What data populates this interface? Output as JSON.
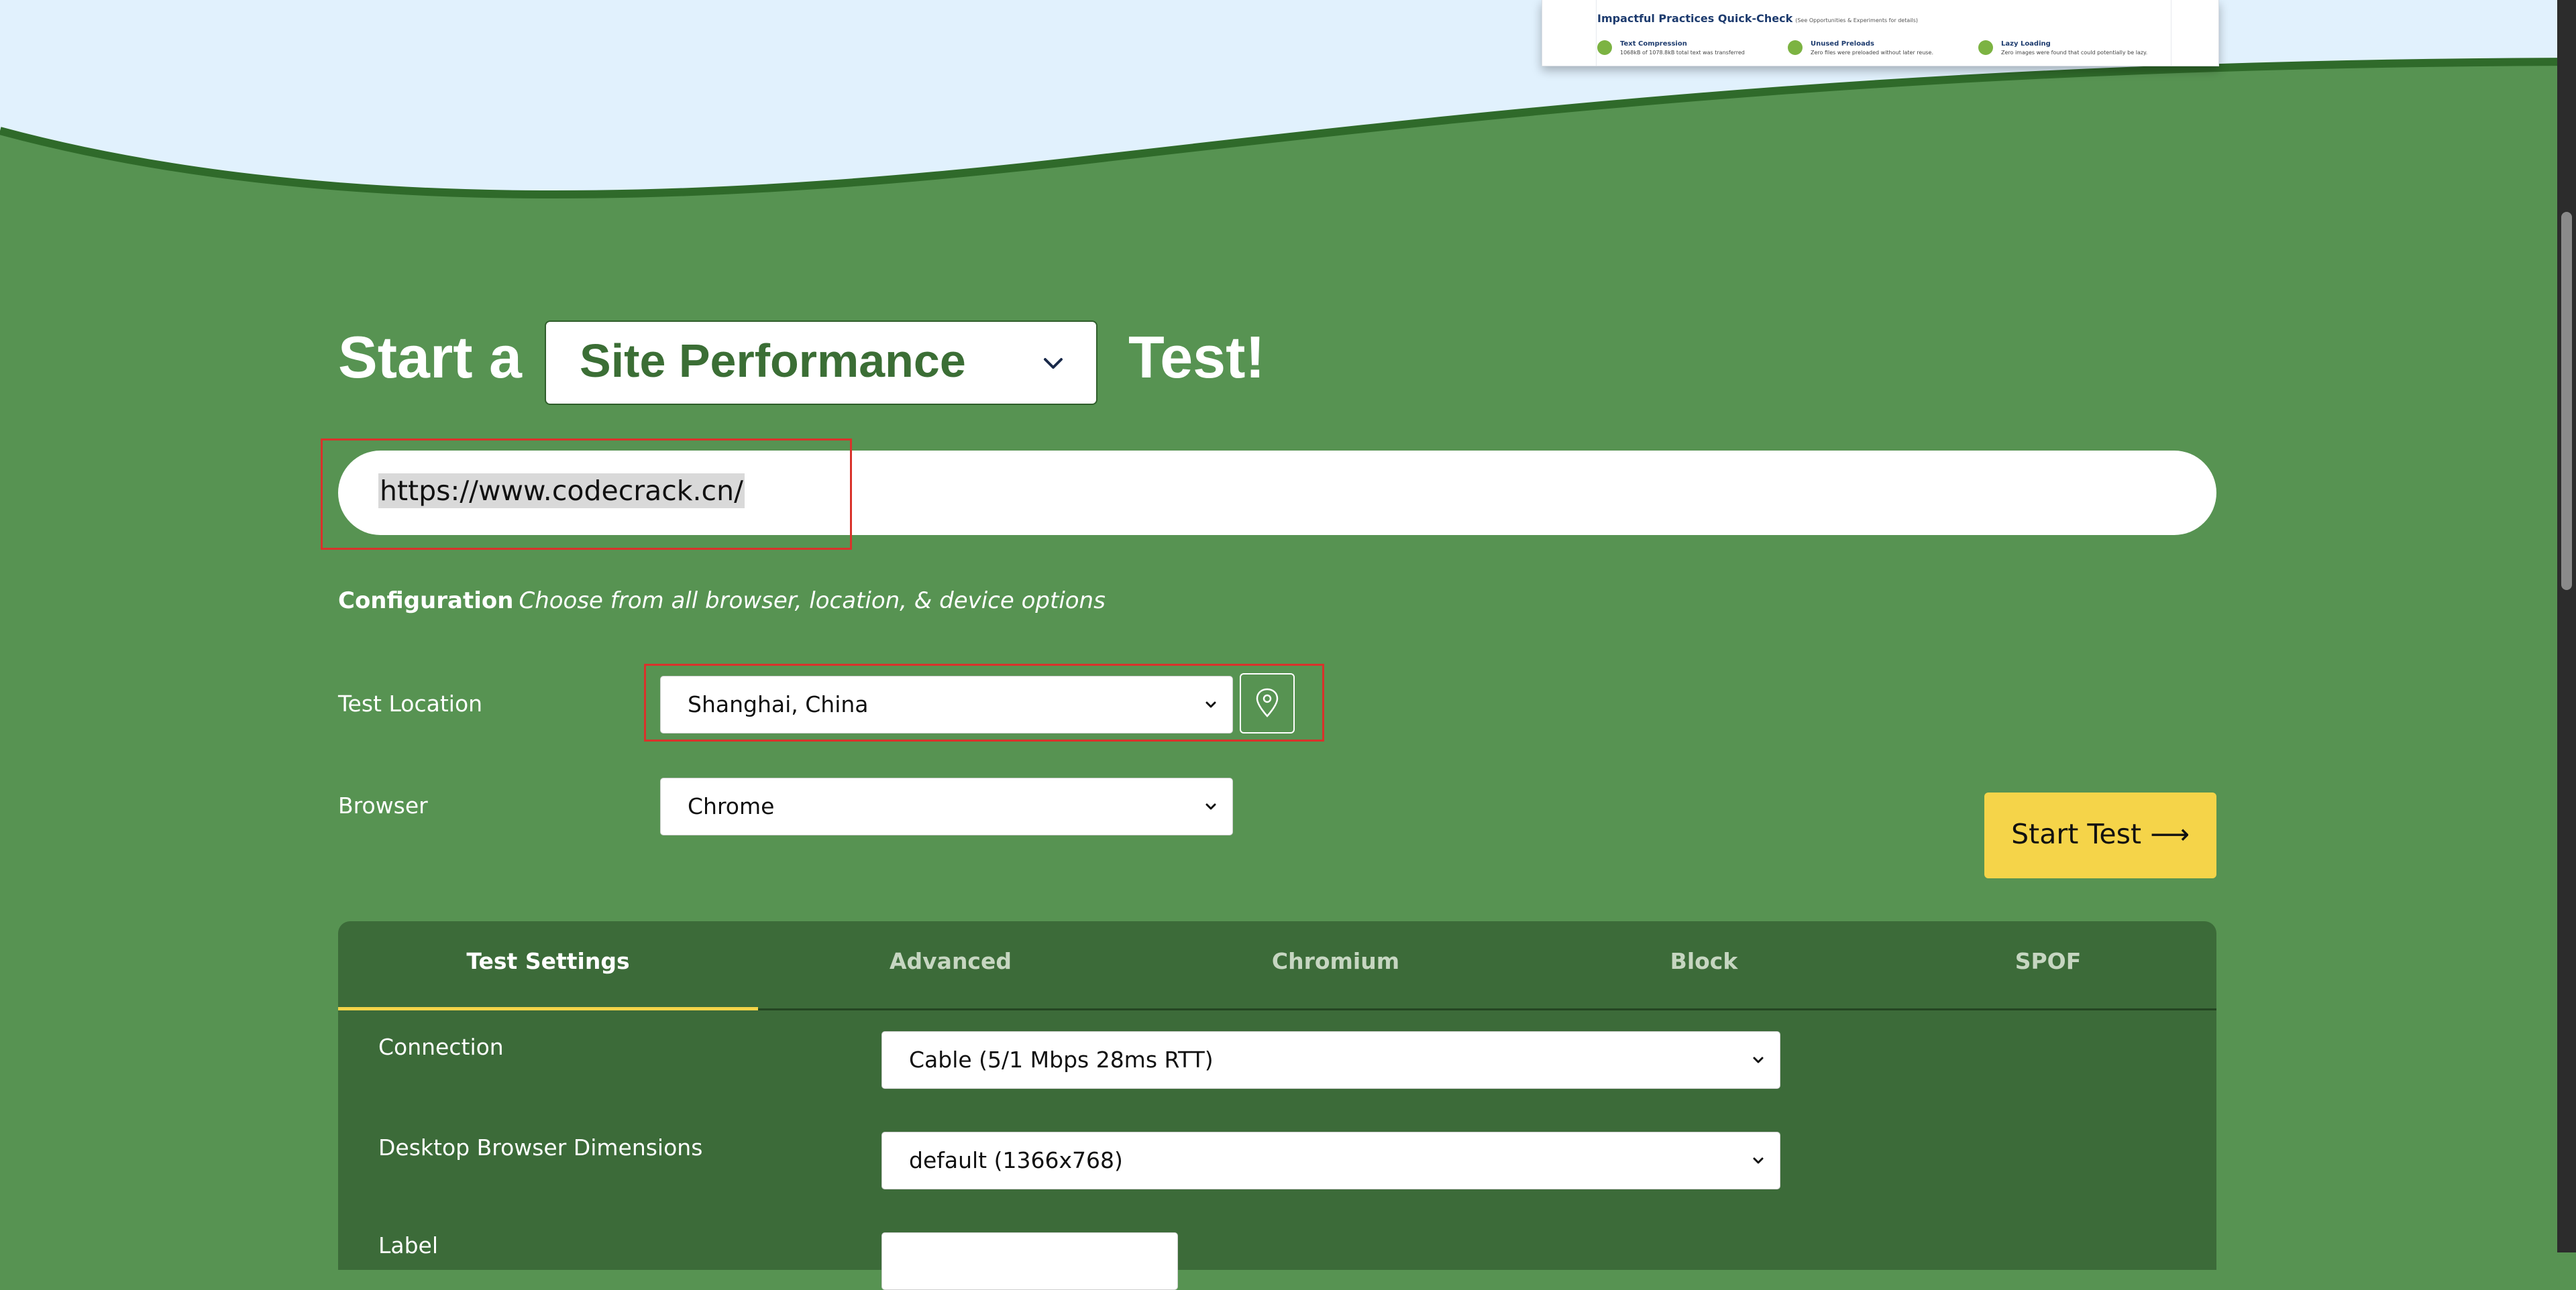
{
  "preview": {
    "title": "Impactful Practices Quick-Check",
    "subtitle": "(See Opportunities & Experiments for details)",
    "items": [
      {
        "heading": "Text Compression",
        "text": "1068kB of 1078.8kB total text was transferred"
      },
      {
        "heading": "Unused Preloads",
        "text": "Zero files were preloaded without later reuse."
      },
      {
        "heading": "Lazy Loading",
        "text": "Zero images were found that could potentially be lazy."
      }
    ]
  },
  "hero": {
    "start_prefix": "Start a",
    "test_type": "Site Performance",
    "start_suffix": "Test!"
  },
  "url_input": {
    "value": "https://www.codecrack.cn/"
  },
  "config": {
    "label": "Configuration",
    "description": "Choose from all browser, location, & device options"
  },
  "test_location": {
    "label": "Test Location",
    "value": "Shanghai, China"
  },
  "browser": {
    "label": "Browser",
    "value": "Chrome"
  },
  "start_button": {
    "label": "Start Test ⟶"
  },
  "tabs": [
    {
      "label": "Test Settings",
      "active": true
    },
    {
      "label": "Advanced",
      "active": false
    },
    {
      "label": "Chromium",
      "active": false
    },
    {
      "label": "Block",
      "active": false
    },
    {
      "label": "SPOF",
      "active": false
    }
  ],
  "settings": {
    "connection": {
      "label": "Connection",
      "value": "Cable (5/1 Mbps 28ms RTT)"
    },
    "dimensions": {
      "label": "Desktop Browser Dimensions",
      "value": "default (1366x768)"
    },
    "label_field": {
      "label": "Label",
      "value": ""
    }
  },
  "colors": {
    "grass": "#579352",
    "panel": "#3c6b39",
    "accent_yellow": "#f5d449",
    "highlight_red": "#d9322b"
  }
}
